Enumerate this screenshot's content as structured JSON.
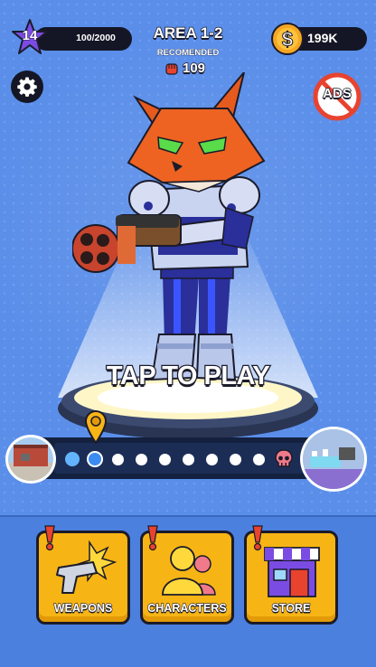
{
  "hud": {
    "level": "14",
    "xp": "100/2000",
    "coins": "199K",
    "area": {
      "title": "AREA 1-2",
      "recommended_label": "RECOMENDED",
      "recommended_power": "109"
    },
    "ads_label": "ADS"
  },
  "main": {
    "tap_prompt": "TAP TO PLAY"
  },
  "progress": {
    "stages_total": 10,
    "current_stage": 2,
    "completed_stages": 1,
    "final_stage_icon": "skull-icon"
  },
  "nav": [
    {
      "label": "WEAPONS",
      "icon": "pistol-icon",
      "alert": true
    },
    {
      "label": "CHARACTERS",
      "icon": "characters-icon",
      "alert": true
    },
    {
      "label": "STORE",
      "icon": "store-icon",
      "alert": true
    }
  ],
  "colors": {
    "background": "#5a8ee9",
    "hud_pill": "#141626",
    "nav_button": "#f7b515",
    "level_star": "#7b4ce3",
    "coin": "#f5a623",
    "no_ads": "#e8432f",
    "alert": "#e8432f"
  }
}
